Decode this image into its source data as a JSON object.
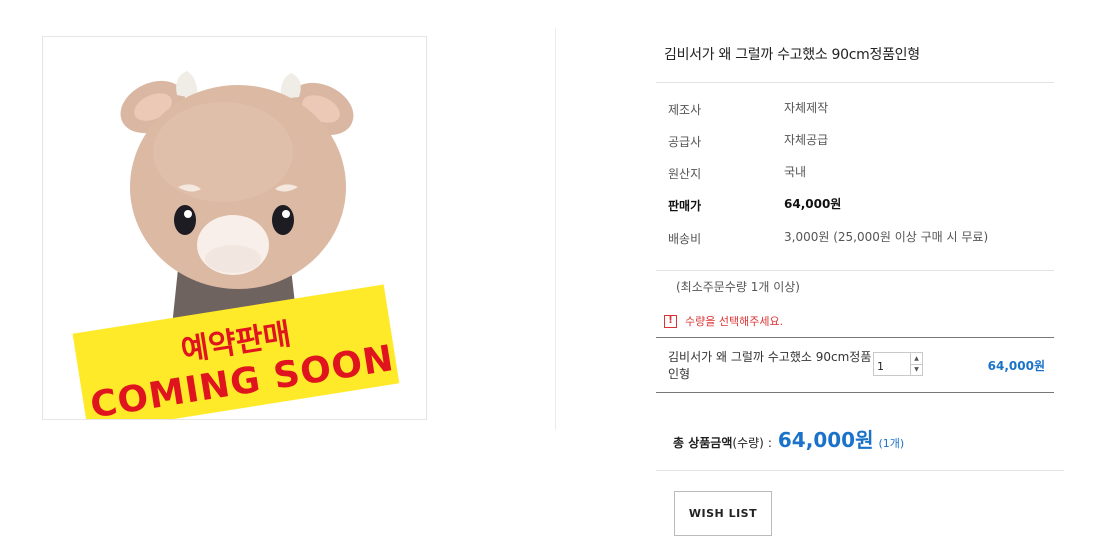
{
  "product": {
    "title": "김비서가 왜 그럴까 수고했소 90cm정품인형",
    "image_banner": {
      "line1": "예약판매",
      "line2": "COMING SOON"
    }
  },
  "info": [
    {
      "label": "제조사",
      "value": "자체제작",
      "bold": false
    },
    {
      "label": "공급사",
      "value": "자체공급",
      "bold": false
    },
    {
      "label": "원산지",
      "value": "국내",
      "bold": false
    },
    {
      "label": "판매가",
      "value": "64,000원",
      "bold": true
    },
    {
      "label": "배송비",
      "value": "3,000원 (25,000원 이상 구매 시 무료)",
      "bold": false
    }
  ],
  "min_order": "(최소주문수량 1개 이상)",
  "warning": {
    "icon": "!",
    "text": "수량을 선택해주세요."
  },
  "option": {
    "name": "김비서가 왜 그럴까 수고했소 90cm정품인형",
    "quantity": "1",
    "price": "64,000원",
    "up": "▲",
    "down": "▼"
  },
  "total": {
    "label": "총 상품금액",
    "sub": "(수량)",
    "colon": ":",
    "price": "64,000원",
    "count": "(1개)"
  },
  "buttons": {
    "wish_list": "WISH LIST"
  },
  "colors": {
    "accent": "#1a73c8",
    "warning": "#d33333",
    "banner_yellow": "#ffea2a",
    "banner_red": "#e0141e"
  }
}
